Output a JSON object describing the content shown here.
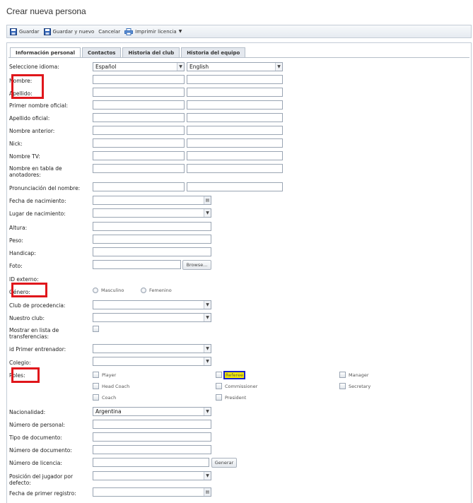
{
  "page": {
    "title": "Crear nueva persona"
  },
  "toolbar": {
    "save": "Guardar",
    "save_new": "Guardar y nuevo",
    "cancel": "Cancelar",
    "print": "Imprimir licencia"
  },
  "tabs": [
    "Información personal",
    "Contactos",
    "Historia del club",
    "Historia del equipo"
  ],
  "form": {
    "language_label": "Seleccione idioma:",
    "language_1": "Español",
    "language_2": "English",
    "nombre": "Nombre:",
    "apellido": "Apellido:",
    "primer_nombre_oficial": "Primer nombre oficial:",
    "apellido_oficial": "Apellido oficial:",
    "nombre_anterior": "Nombre anterior:",
    "nick": "Nick:",
    "nombre_tv": "Nombre TV:",
    "nombre_anotadores": "Nombre en tabla de anotadores:",
    "pronunciacion": "Pronunciación del nombre:",
    "fecha_nacimiento": "Fecha de nacimiento:",
    "lugar_nacimiento": "Lugar de nacimiento:",
    "altura": "Altura:",
    "peso": "Peso:",
    "handicap": "Handicap:",
    "foto": "Foto:",
    "browse": "Browse...",
    "id_externo": "ID externo:",
    "genero": "Género:",
    "masculino": "Masculino",
    "femenino": "Femenino",
    "club_procedencia": "Club de procedencia:",
    "nuestro_club": "Nuestro club:",
    "mostrar_transferencias": "Mostrar en lista de transferencias:",
    "primer_entrenador": "id Primer entrenador:",
    "colegio": "Colegio:",
    "roles": "Roles:",
    "nacionalidad": "Nacionalidad:",
    "nacionalidad_value": "Argentina",
    "numero_personal": "Número de personal:",
    "tipo_documento": "Tipo de documento:",
    "numero_documento": "Número de documento:",
    "numero_licencia": "Número de licencia:",
    "generar": "Generar",
    "posicion": "Posición del jugador por defecto:",
    "fecha_primer_registro": "Fecha de primer registro:"
  },
  "roles": {
    "player": "Player",
    "head_coach": "Head Coach",
    "coach": "Coach",
    "referee": "Referee",
    "commissioner": "Commissioner",
    "president": "President",
    "manager": "Manager",
    "secretary": "Secretary"
  },
  "icons": {
    "save": "floppy-disk-icon",
    "save_new": "floppy-disk-icon",
    "print": "printer-icon",
    "dropdown": "chevron-down-icon",
    "calendar": "calendar-icon"
  },
  "colors": {
    "highlight_red": "#e0161b",
    "highlight_yellow": "#f7ec00",
    "highlight_blue": "#1a22c9"
  }
}
